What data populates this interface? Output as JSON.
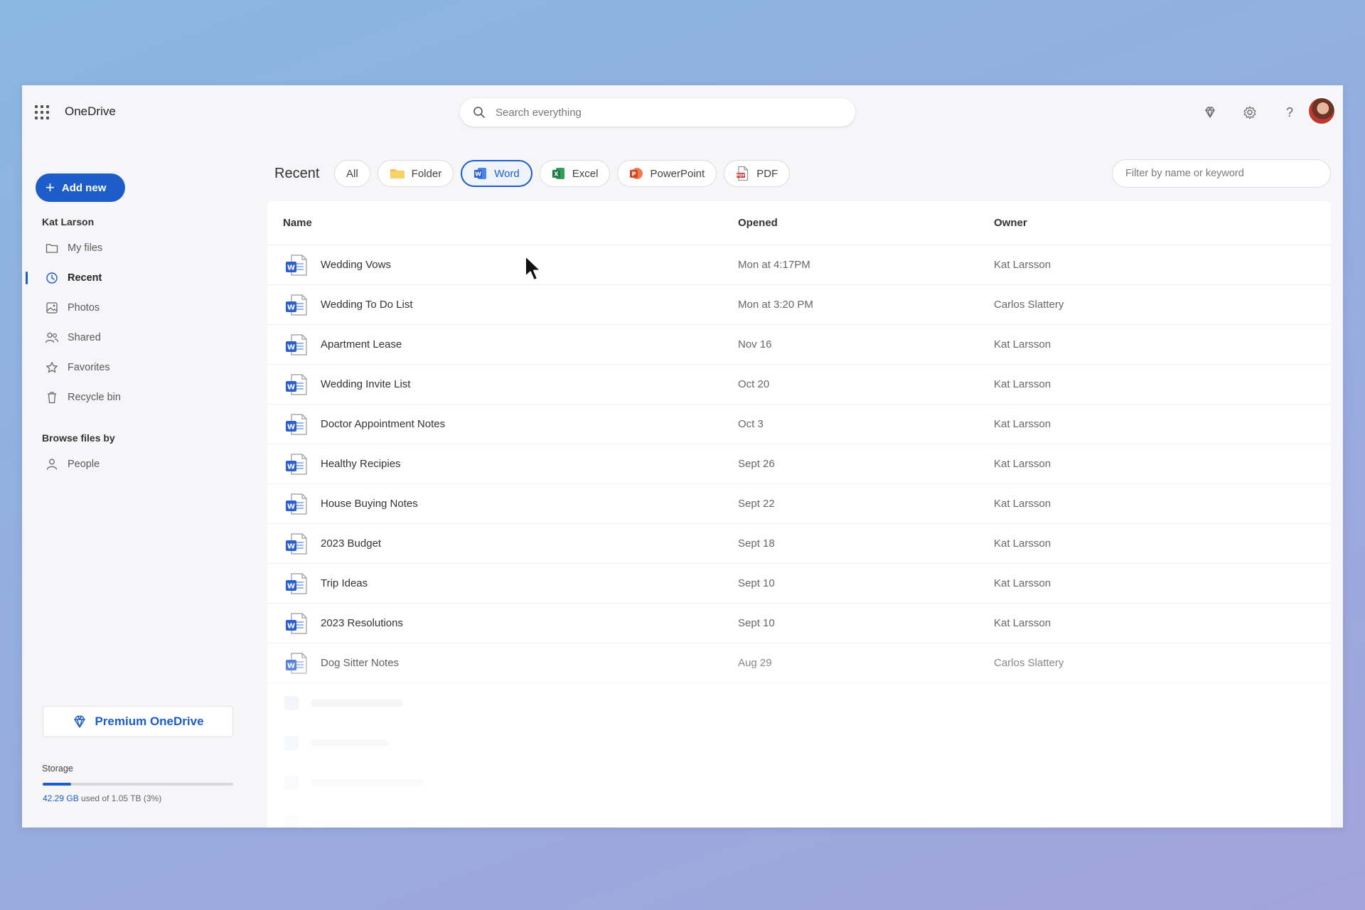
{
  "app": {
    "title": "OneDrive"
  },
  "search": {
    "placeholder": "Search everything"
  },
  "sidebar": {
    "add_new_label": "Add new",
    "user_section": "Kat Larson",
    "items": [
      {
        "label": "My files",
        "icon": "folder-icon"
      },
      {
        "label": "Recent",
        "icon": "clock-icon",
        "active": true
      },
      {
        "label": "Photos",
        "icon": "image-icon"
      },
      {
        "label": "Shared",
        "icon": "people-icon"
      },
      {
        "label": "Favorites",
        "icon": "star-icon"
      },
      {
        "label": "Recycle bin",
        "icon": "trash-icon"
      }
    ],
    "browse_section": "Browse files by",
    "browse_items": [
      {
        "label": "People",
        "icon": "person-icon"
      }
    ],
    "premium_label": "Premium OneDrive",
    "storage": {
      "label": "Storage",
      "used": "42.29 GB",
      "rest": "used of 1.05 TB (3%)",
      "fraction": 0.15
    }
  },
  "main": {
    "section_title": "Recent",
    "chips": [
      {
        "label": "All",
        "icon": ""
      },
      {
        "label": "Folder",
        "icon": "folder-yellow-icon"
      },
      {
        "label": "Word",
        "icon": "word-icon",
        "selected": true
      },
      {
        "label": "Excel",
        "icon": "excel-icon"
      },
      {
        "label": "PowerPoint",
        "icon": "powerpoint-icon"
      },
      {
        "label": "PDF",
        "icon": "pdf-icon"
      }
    ],
    "filter_placeholder": "Filter by name or keyword",
    "columns": {
      "name": "Name",
      "opened": "Opened",
      "owner": "Owner"
    },
    "rows": [
      {
        "name": "Wedding Vows",
        "opened": "Mon at 4:17PM",
        "owner": "Kat Larsson"
      },
      {
        "name": "Wedding To Do List",
        "opened": "Mon at 3:20 PM",
        "owner": "Carlos Slattery"
      },
      {
        "name": "Apartment Lease",
        "opened": "Nov 16",
        "owner": "Kat Larsson"
      },
      {
        "name": "Wedding Invite List",
        "opened": "Oct 20",
        "owner": "Kat Larsson"
      },
      {
        "name": "Doctor Appointment Notes",
        "opened": "Oct 3",
        "owner": "Kat Larsson"
      },
      {
        "name": "Healthy Recipies",
        "opened": "Sept 26",
        "owner": "Kat Larsson"
      },
      {
        "name": "House Buying Notes",
        "opened": "Sept 22",
        "owner": "Kat Larsson"
      },
      {
        "name": "2023 Budget",
        "opened": "Sept 18",
        "owner": "Kat Larsson"
      },
      {
        "name": "Trip Ideas",
        "opened": "Sept 10",
        "owner": "Kat Larsson"
      },
      {
        "name": "2023 Resolutions",
        "opened": "Sept 10",
        "owner": "Kat Larsson"
      },
      {
        "name": "Dog Sitter Notes",
        "opened": "Aug 29",
        "owner": "Carlos Slattery"
      }
    ]
  },
  "colors": {
    "accent": "#1d5dc9",
    "word": "#2b5fcb",
    "excel": "#1f7a44",
    "powerpoint": "#d24726",
    "folder": "#f4c142"
  }
}
